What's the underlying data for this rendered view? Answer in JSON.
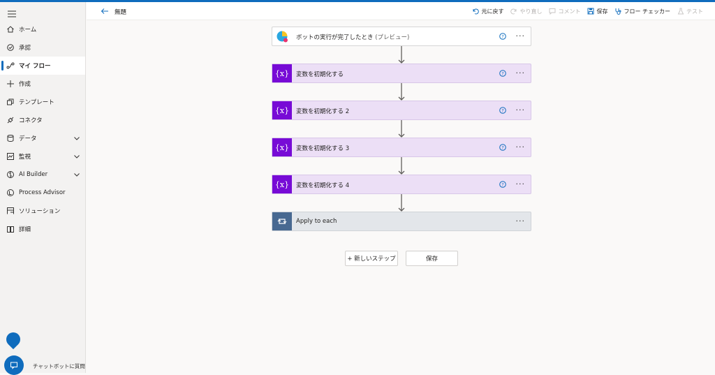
{
  "header": {
    "flow_title": "無題",
    "toolbar": {
      "undo": "元に戻す",
      "redo": "やり直し",
      "comment": "コメント",
      "save": "保存",
      "flow_checker": "フロー チェッカー",
      "test": "テスト"
    }
  },
  "sidebar": {
    "items": [
      {
        "label": "ホーム",
        "icon": "home-icon"
      },
      {
        "label": "承認",
        "icon": "approvals-icon"
      },
      {
        "label": "マイ フロー",
        "icon": "flows-icon",
        "active": true
      },
      {
        "label": "作成",
        "icon": "create-icon"
      },
      {
        "label": "テンプレート",
        "icon": "templates-icon"
      },
      {
        "label": "コネクタ",
        "icon": "connectors-icon"
      },
      {
        "label": "データ",
        "icon": "data-icon",
        "expandable": true
      },
      {
        "label": "監視",
        "icon": "monitor-icon",
        "expandable": true
      },
      {
        "label": "AI Builder",
        "icon": "ai-builder-icon",
        "expandable": true
      },
      {
        "label": "Process Advisor",
        "icon": "process-advisor-icon"
      },
      {
        "label": "ソリューション",
        "icon": "solutions-icon"
      },
      {
        "label": "詳細",
        "icon": "learn-icon"
      }
    ],
    "chat_label": "チャットボットに質問"
  },
  "flow": {
    "trigger": {
      "title": "ボットの実行が完了したとき",
      "preview_tag": "(プレビュー)"
    },
    "steps": [
      {
        "title": "変数を初期化する"
      },
      {
        "title": "変数を初期化する 2"
      },
      {
        "title": "変数を初期化する 3"
      },
      {
        "title": "変数を初期化する 4"
      }
    ],
    "loop": {
      "title": "Apply to each"
    },
    "more_glyph": "···"
  },
  "actions": {
    "new_step": "+ 新しいステップ",
    "save": "保存"
  },
  "colors": {
    "accent": "#0f6cbd",
    "variable_icon_bg": "#770bd6",
    "variable_card_bg": "#ecdff6",
    "loop_icon_bg": "#486991",
    "loop_card_bg": "#e3e6ea"
  }
}
